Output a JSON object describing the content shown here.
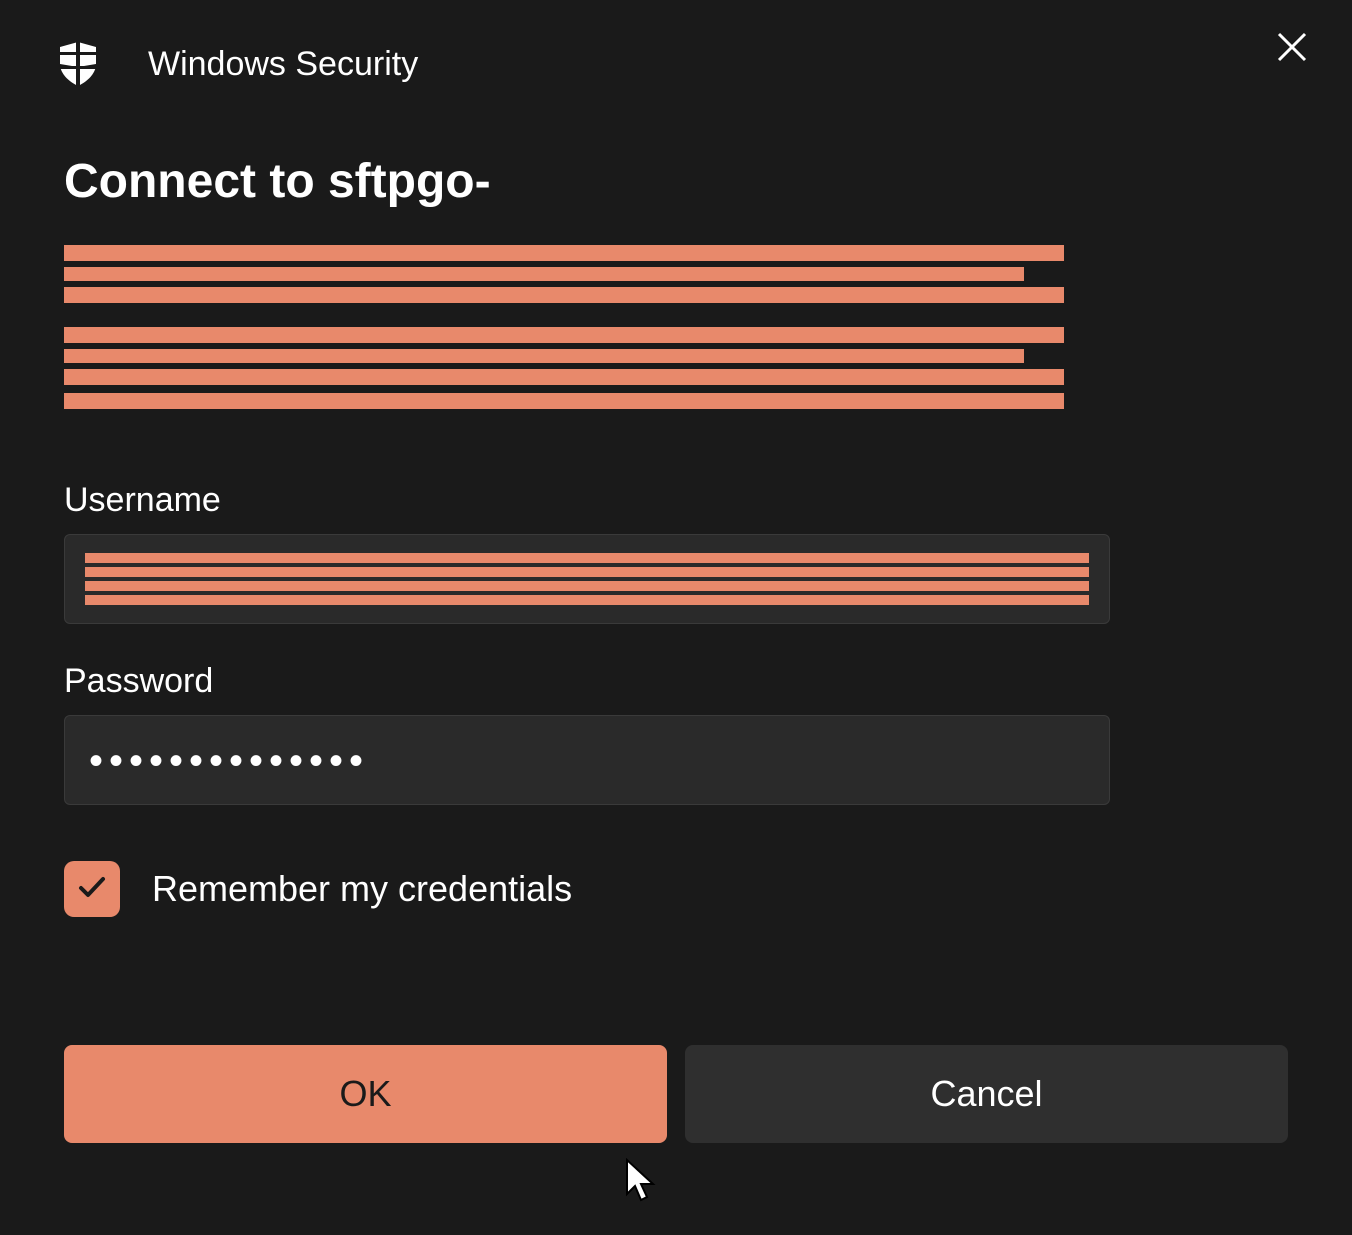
{
  "header": {
    "title": "Windows Security"
  },
  "dialog": {
    "main_title": "Connect to sftpgo-",
    "username_label": "Username",
    "username_value": "",
    "password_label": "Password",
    "password_value": "••••••••••••••",
    "remember_label": "Remember my credentials",
    "remember_checked": true
  },
  "buttons": {
    "ok": "OK",
    "cancel": "Cancel"
  },
  "colors": {
    "accent": "#e8896b",
    "background": "#1a1a1a",
    "input_bg": "#2a2a2a"
  }
}
